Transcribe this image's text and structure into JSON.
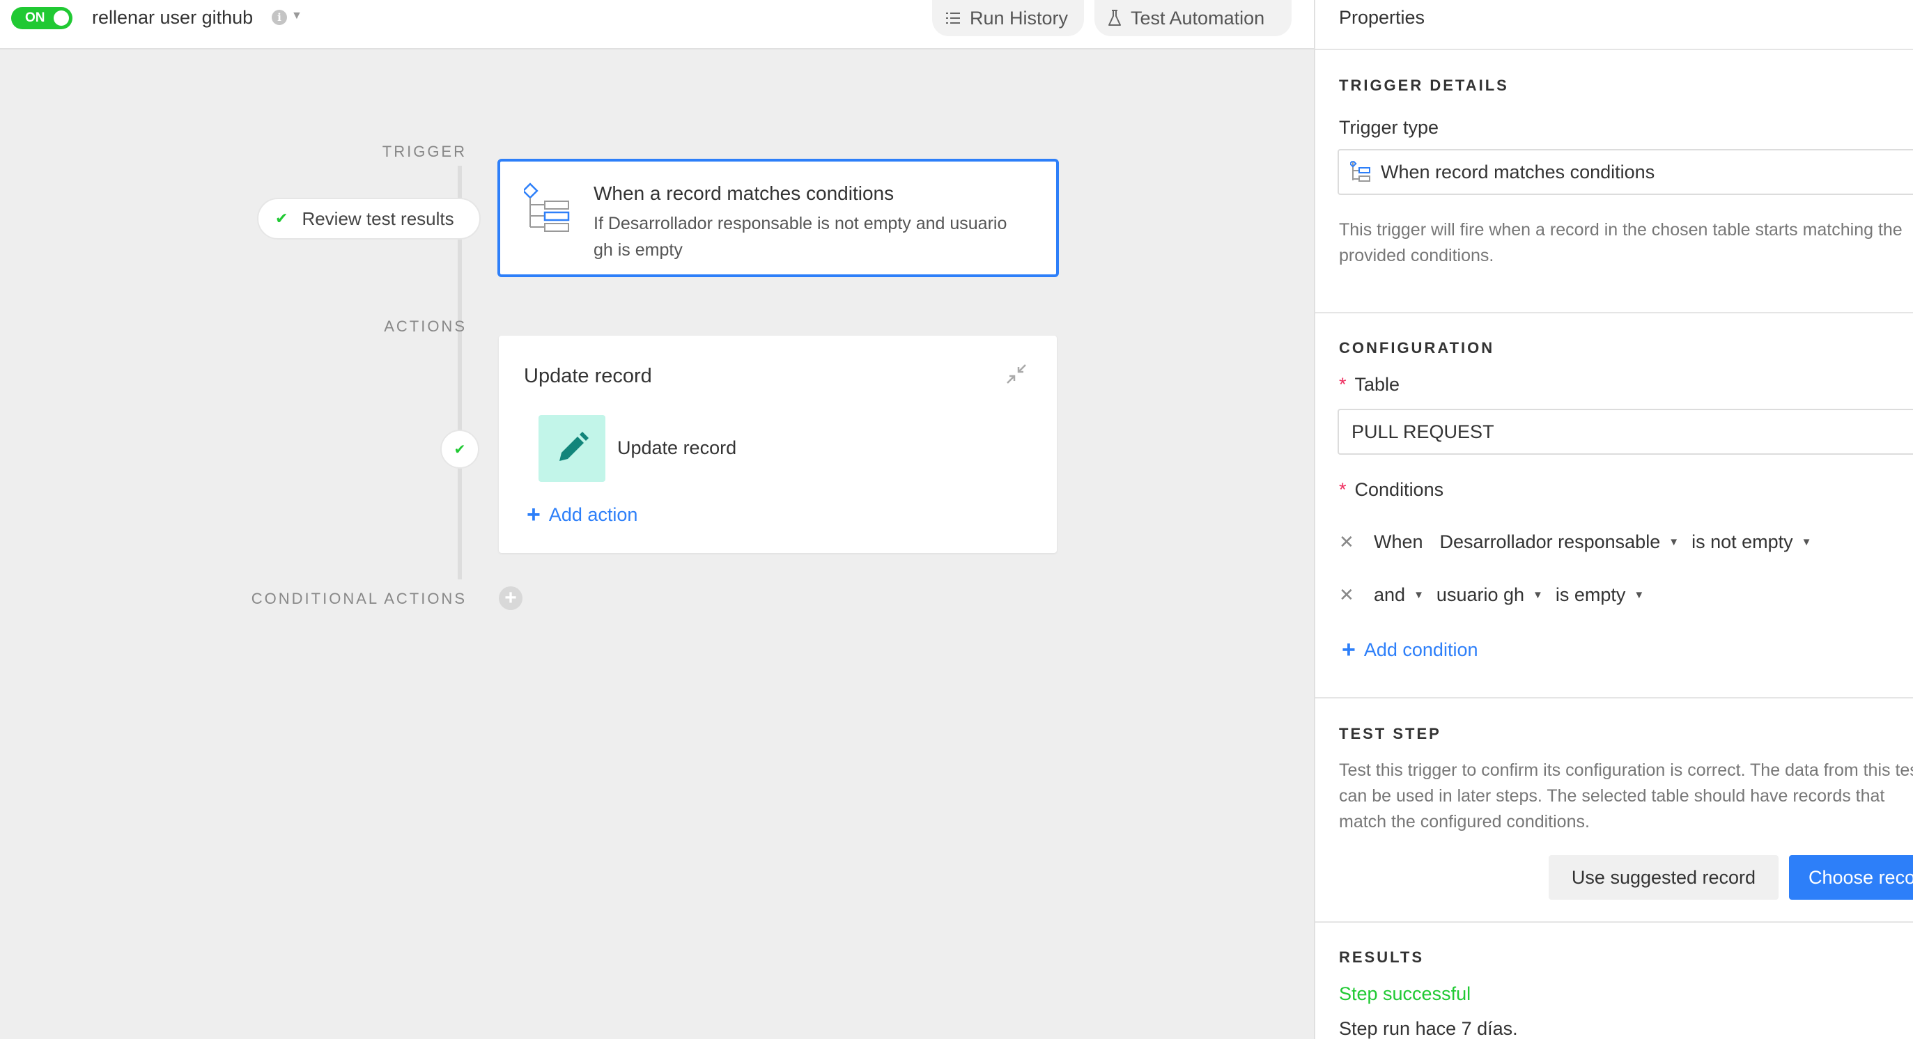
{
  "header": {
    "toggle_label": "ON",
    "automation_name": "rellenar user github",
    "run_history_label": "Run History",
    "test_automation_label": "Test Automation"
  },
  "canvas": {
    "trigger_label": "TRIGGER",
    "actions_label": "ACTIONS",
    "conditional_actions_label": "CONDITIONAL ACTIONS",
    "review_test_results_label": "Review test results",
    "trigger_card": {
      "title": "When a record matches conditions",
      "description": "If Desarrollador responsable is not empty and usuario gh is empty"
    },
    "action_card": {
      "title": "Update record",
      "item_label": "Update record",
      "add_action_label": "Add action"
    }
  },
  "properties": {
    "title": "Properties",
    "trigger_details": {
      "heading": "TRIGGER DETAILS",
      "trigger_type_label": "Trigger type",
      "trigger_type_value": "When record matches conditions",
      "help": "This trigger will fire when a record in the chosen table starts matching the provided conditions."
    },
    "configuration": {
      "heading": "CONFIGURATION",
      "table_label": "Table",
      "table_value": "PULL REQUEST",
      "conditions_label": "Conditions",
      "conditions": [
        {
          "conjunction": "When",
          "field": "Desarrollador responsable",
          "operator": "is not empty"
        },
        {
          "conjunction": "and",
          "field": "usuario gh",
          "operator": "is empty"
        }
      ],
      "add_condition_label": "Add condition"
    },
    "test_step": {
      "heading": "TEST STEP",
      "help": "Test this trigger to confirm its configuration is correct. The data from this test can be used in later steps. The selected table should have records that match the configured conditions.",
      "use_suggested_label": "Use suggested record",
      "choose_record_label": "Choose record"
    },
    "results": {
      "heading": "RESULTS",
      "status": "Step successful",
      "run_time": "Step run hace 7 días."
    }
  },
  "colors": {
    "accent_blue": "#2d7ff9",
    "success_green": "#20c933",
    "required_red": "#ef3061",
    "action_icon_bg": "#c2f5e9"
  }
}
